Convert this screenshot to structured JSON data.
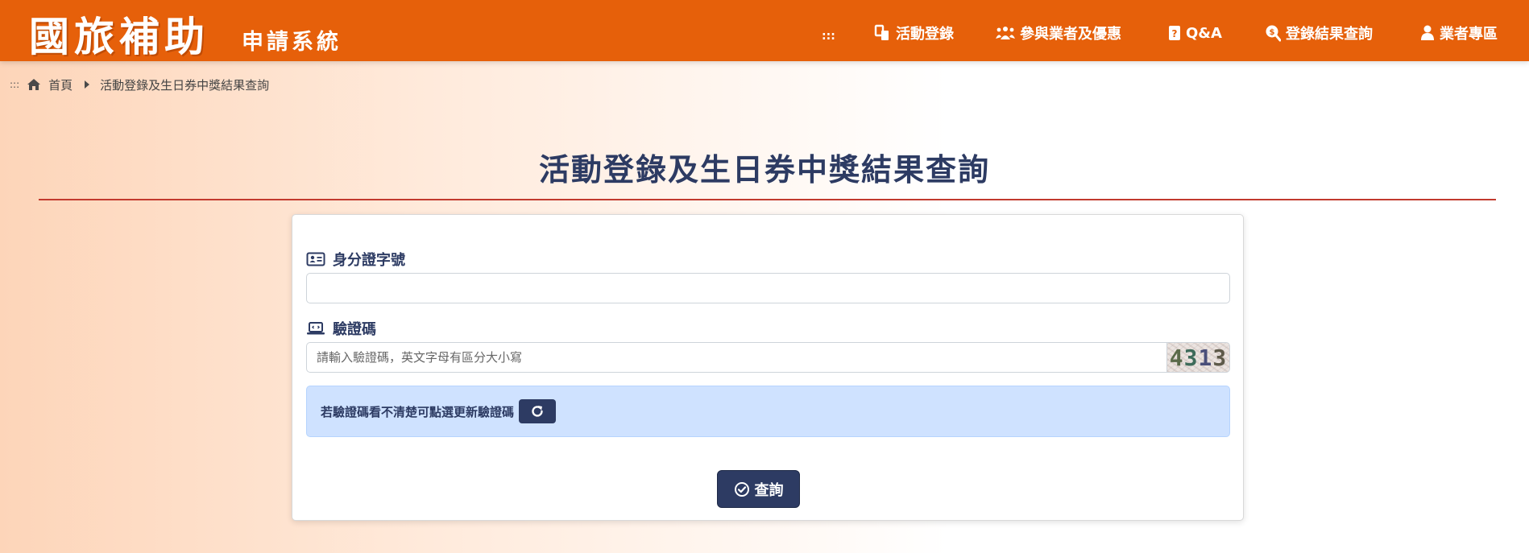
{
  "header": {
    "logo_main": "國旅補助",
    "logo_sub": "申請系統",
    "accesskey": ":::",
    "nav": [
      {
        "label": "活動登錄",
        "icon": "register-icon"
      },
      {
        "label": "參與業者及優惠",
        "icon": "group-icon"
      },
      {
        "label": "Q&A",
        "icon": "question-icon"
      },
      {
        "label": "登錄結果查詢",
        "icon": "search-result-icon"
      },
      {
        "label": "業者專區",
        "icon": "user-icon"
      }
    ]
  },
  "breadcrumb": {
    "accesskey": ":::",
    "home": "首頁",
    "current": "活動登錄及生日券中獎結果查詢"
  },
  "page_title": "活動登錄及生日券中獎結果查詢",
  "form": {
    "id_label": "身分證字號",
    "id_value": "",
    "captcha_label": "驗證碼",
    "captcha_placeholder": "請輸入驗證碼，英文字母有區分大小寫",
    "captcha_chars": [
      "4",
      "3",
      "1",
      "3"
    ],
    "refresh_hint": "若驗證碼看不清楚可點選更新驗證碼",
    "submit_label": "查詢"
  },
  "colors": {
    "header_bg": "#e6600a",
    "primary": "#2d3b63",
    "title_rule": "#c23a2e",
    "alert_bg": "#cfe2ff"
  }
}
